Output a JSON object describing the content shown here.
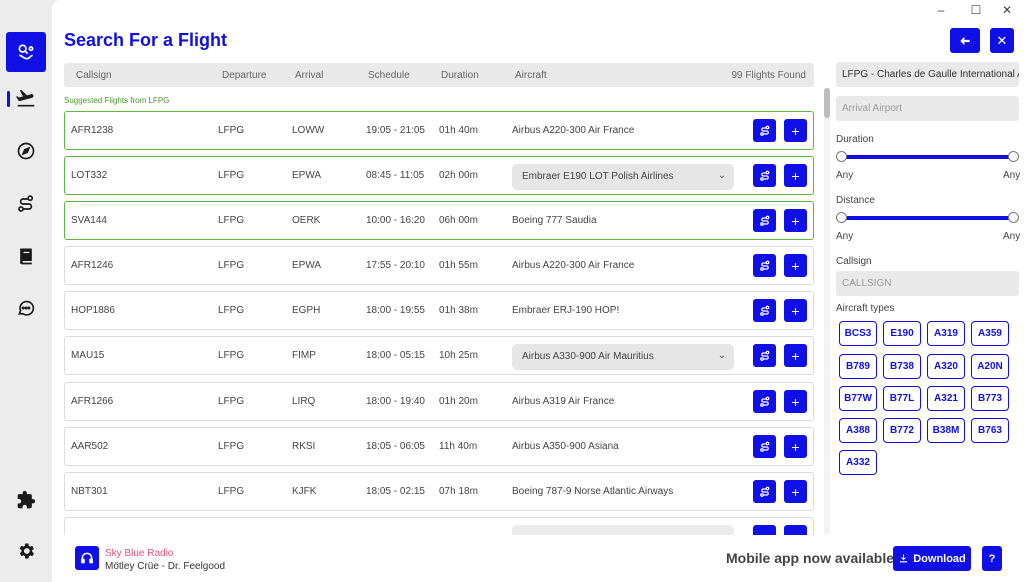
{
  "title": "Search For a Flight",
  "table": {
    "headers": {
      "callsign": "Callsign",
      "departure": "Departure",
      "arrival": "Arrival",
      "schedule": "Schedule",
      "duration": "Duration",
      "aircraft": "Aircraft",
      "count": "99 Flights Found"
    },
    "suggested_label": "Suggested Flights from LFPG",
    "rows": [
      {
        "callsign": "AFR1238",
        "dep": "LFPG",
        "arr": "LOWW",
        "schedule": "19:05 - 21:05",
        "duration": "01h 40m",
        "aircraft": "Airbus A220-300 Air France"
      },
      {
        "callsign": "LOT332",
        "dep": "LFPG",
        "arr": "EPWA",
        "schedule": "08:45 - 11:05",
        "duration": "02h 00m",
        "aircraft": "Embraer E190 LOT Polish Airlines"
      },
      {
        "callsign": "SVA144",
        "dep": "LFPG",
        "arr": "OERK",
        "schedule": "10:00 - 16:20",
        "duration": "06h 00m",
        "aircraft": "Boeing 777 Saudia"
      },
      {
        "callsign": "AFR1246",
        "dep": "LFPG",
        "arr": "EPWA",
        "schedule": "17:55 - 20:10",
        "duration": "01h 55m",
        "aircraft": "Airbus A220-300 Air France"
      },
      {
        "callsign": "HOP1886",
        "dep": "LFPG",
        "arr": "EGPH",
        "schedule": "18:00 - 19:55",
        "duration": "01h 38m",
        "aircraft": "Embraer ERJ-190 HOP!"
      },
      {
        "callsign": "MAU15",
        "dep": "LFPG",
        "arr": "FIMP",
        "schedule": "18:00 - 05:15",
        "duration": "10h 25m",
        "aircraft": "Airbus A330-900 Air Mauritius"
      },
      {
        "callsign": "AFR1266",
        "dep": "LFPG",
        "arr": "LIRQ",
        "schedule": "18:00 - 19:40",
        "duration": "01h 20m",
        "aircraft": "Airbus A319 Air France"
      },
      {
        "callsign": "AAR502",
        "dep": "LFPG",
        "arr": "RKSI",
        "schedule": "18:05 - 06:05",
        "duration": "11h 40m",
        "aircraft": "Airbus A350-900 Asiana"
      },
      {
        "callsign": "NBT301",
        "dep": "LFPG",
        "arr": "KJFK",
        "schedule": "18:05 - 02:15",
        "duration": "07h 18m",
        "aircraft": "Boeing 787-9 Norse Atlantic Airways"
      }
    ]
  },
  "filters": {
    "departure_value": "LFPG - Charles de Gaulle International Airport",
    "arrival_placeholder": "Arrival Airport",
    "duration_label": "Duration",
    "duration_min": "Any",
    "duration_max": "Any",
    "distance_label": "Distance",
    "distance_min": "Any",
    "distance_max": "Any",
    "callsign_label": "Callsign",
    "callsign_placeholder": "CALLSIGN",
    "aircraft_types_label": "Aircraft types",
    "aircraft_types": [
      "BCS3",
      "E190",
      "A319",
      "A359",
      "B789",
      "B738",
      "A320",
      "A20N",
      "B77W",
      "B77L",
      "A321",
      "B773",
      "A388",
      "B772",
      "B38M",
      "B763",
      "A332"
    ]
  },
  "footer": {
    "radio_name": "Sky Blue Radio",
    "radio_track": "Mötley Crüe - Dr. Feelgood",
    "promo": "Mobile app now available!",
    "download_label": "Download",
    "help_label": "?"
  },
  "window": {
    "minimize": "–",
    "maximize": "☐",
    "close": "✕"
  },
  "colors": {
    "accent": "#1010e6",
    "suggested_border": "#62b543",
    "radio_text": "#e05580"
  }
}
